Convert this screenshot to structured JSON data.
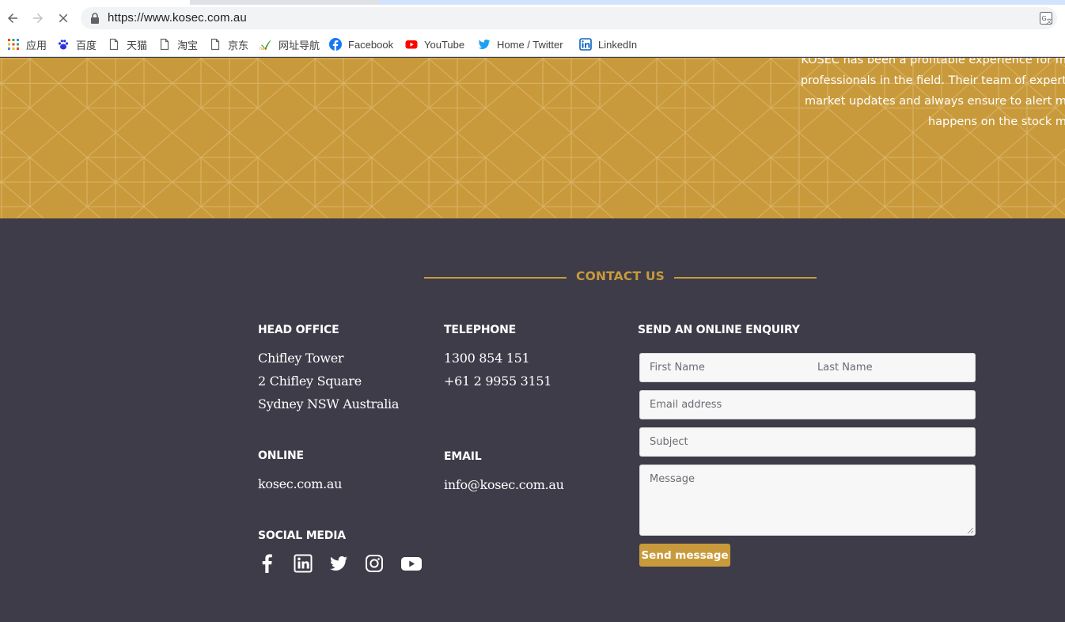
{
  "browser": {
    "url": "https://www.kosec.com.au",
    "bookmarks": [
      {
        "label": "应用",
        "icon": "apps-grid-icon"
      },
      {
        "label": "百度",
        "icon": "baidu-paw-icon"
      },
      {
        "label": "天猫",
        "icon": "page-icon"
      },
      {
        "label": "淘宝",
        "icon": "page-icon"
      },
      {
        "label": "京东",
        "icon": "page-icon"
      },
      {
        "label": "网址导航",
        "icon": "hao123-icon"
      },
      {
        "label": "Facebook",
        "icon": "facebook-icon"
      },
      {
        "label": "YouTube",
        "icon": "youtube-icon"
      },
      {
        "label": "Home / Twitter",
        "icon": "twitter-icon"
      },
      {
        "label": "LinkedIn",
        "icon": "linkedin-icon"
      }
    ]
  },
  "banner": {
    "lines": [
      "KOSEC has been a profitable experience for m",
      "professionals in the field. Their team of expert",
      "market updates and always ensure to alert m",
      "happens on the stock m"
    ]
  },
  "contact": {
    "title": "CONTACT US",
    "head_office": {
      "heading": "HEAD OFFICE",
      "lines": [
        "Chifley Tower",
        "2 Chifley Square",
        "Sydney NSW Australia"
      ]
    },
    "telephone": {
      "heading": "TELEPHONE",
      "lines": [
        "1300 854 151",
        "+61 2 9955 3151"
      ]
    },
    "online": {
      "heading": "ONLINE",
      "value": "kosec.com.au"
    },
    "email": {
      "heading": "EMAIL",
      "value": "info@kosec.com.au"
    },
    "social": {
      "heading": "SOCIAL MEDIA",
      "icons": [
        "facebook-icon",
        "linkedin-icon",
        "twitter-icon",
        "instagram-icon",
        "youtube-icon"
      ]
    },
    "enquiry": {
      "heading": "SEND AN ONLINE ENQUIRY",
      "first_name_placeholder": "First Name",
      "last_name_placeholder": "Last Name",
      "email_placeholder": "Email address",
      "subject_placeholder": "Subject",
      "message_placeholder": "Message",
      "submit_label": "Send message"
    }
  },
  "colors": {
    "accent_gold": "#c99a3b",
    "footer_bg": "#3d3c48",
    "text_white": "#ffffff"
  }
}
